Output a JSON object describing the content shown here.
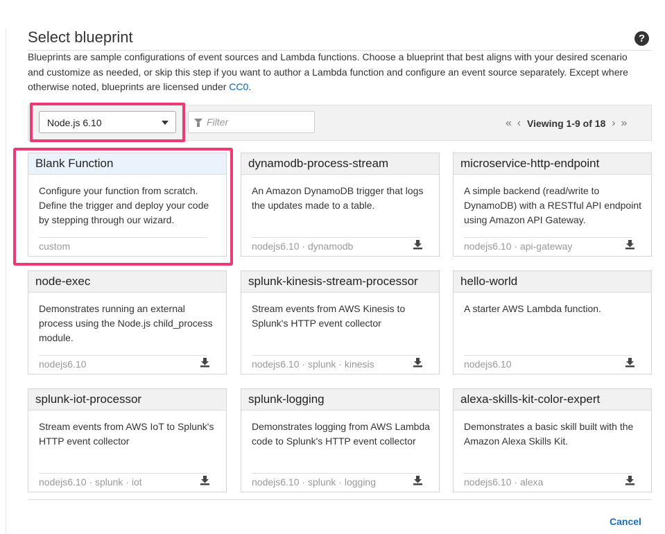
{
  "page": {
    "title": "Select blueprint",
    "help_glyph": "?",
    "description_prefix": "Blueprints are sample configurations of event sources and Lambda functions. Choose a blueprint that best aligns with your desired scenario and customize as needed, or skip this step if you want to author a Lambda function and configure an event source separately. Except where otherwise noted, blueprints are licensed under ",
    "license_link": "CC0",
    "description_suffix": "."
  },
  "toolbar": {
    "runtime": "Node.js 6.10",
    "filter_placeholder": "Filter",
    "pager": {
      "first": "«",
      "prev": "‹",
      "text": "Viewing 1-9 of 18",
      "next": "›",
      "last": "»"
    }
  },
  "blueprints": [
    {
      "name": "Blank Function",
      "description": "Configure your function from scratch. Define the trigger and deploy your code by stepping through our wizard.",
      "tags": "custom",
      "download": false,
      "selected": true
    },
    {
      "name": "dynamodb-process-stream",
      "description": "An Amazon DynamoDB trigger that logs the updates made to a table.",
      "tags": "nodejs6.10 · dynamodb",
      "download": true
    },
    {
      "name": "microservice-http-endpoint",
      "description": "A simple backend (read/write to DynamoDB) with a RESTful API endpoint using Amazon API Gateway.",
      "tags": "nodejs6.10 · api-gateway",
      "download": true
    },
    {
      "name": "node-exec",
      "description": "Demonstrates running an external process using the Node.js child_process module.",
      "tags": "nodejs6.10",
      "download": true
    },
    {
      "name": "splunk-kinesis-stream-processor",
      "description": "Stream events from AWS Kinesis to Splunk's HTTP event collector",
      "tags": "nodejs6.10 · splunk · kinesis",
      "download": true
    },
    {
      "name": "hello-world",
      "description": "A starter AWS Lambda function.",
      "tags": "nodejs6.10",
      "download": true
    },
    {
      "name": "splunk-iot-processor",
      "description": "Stream events from AWS IoT to Splunk's HTTP event collector",
      "tags": "nodejs6.10 · splunk · iot",
      "download": true
    },
    {
      "name": "splunk-logging",
      "description": "Demonstrates logging from AWS Lambda code to Splunk's HTTP event collector",
      "tags": "nodejs6.10 · splunk · logging",
      "download": true
    },
    {
      "name": "alexa-skills-kit-color-expert",
      "description": "Demonstrates a basic skill built with the Amazon Alexa Skills Kit.",
      "tags": "nodejs6.10 · alexa",
      "download": true
    }
  ],
  "footer": {
    "cancel_label": "Cancel"
  },
  "colors": {
    "highlight": "#ee3a74",
    "link": "#0066bb"
  },
  "icons": {
    "help": "help-icon",
    "filter": "filter-icon",
    "download": "download-icon",
    "dropdown": "chevron-down-icon"
  }
}
